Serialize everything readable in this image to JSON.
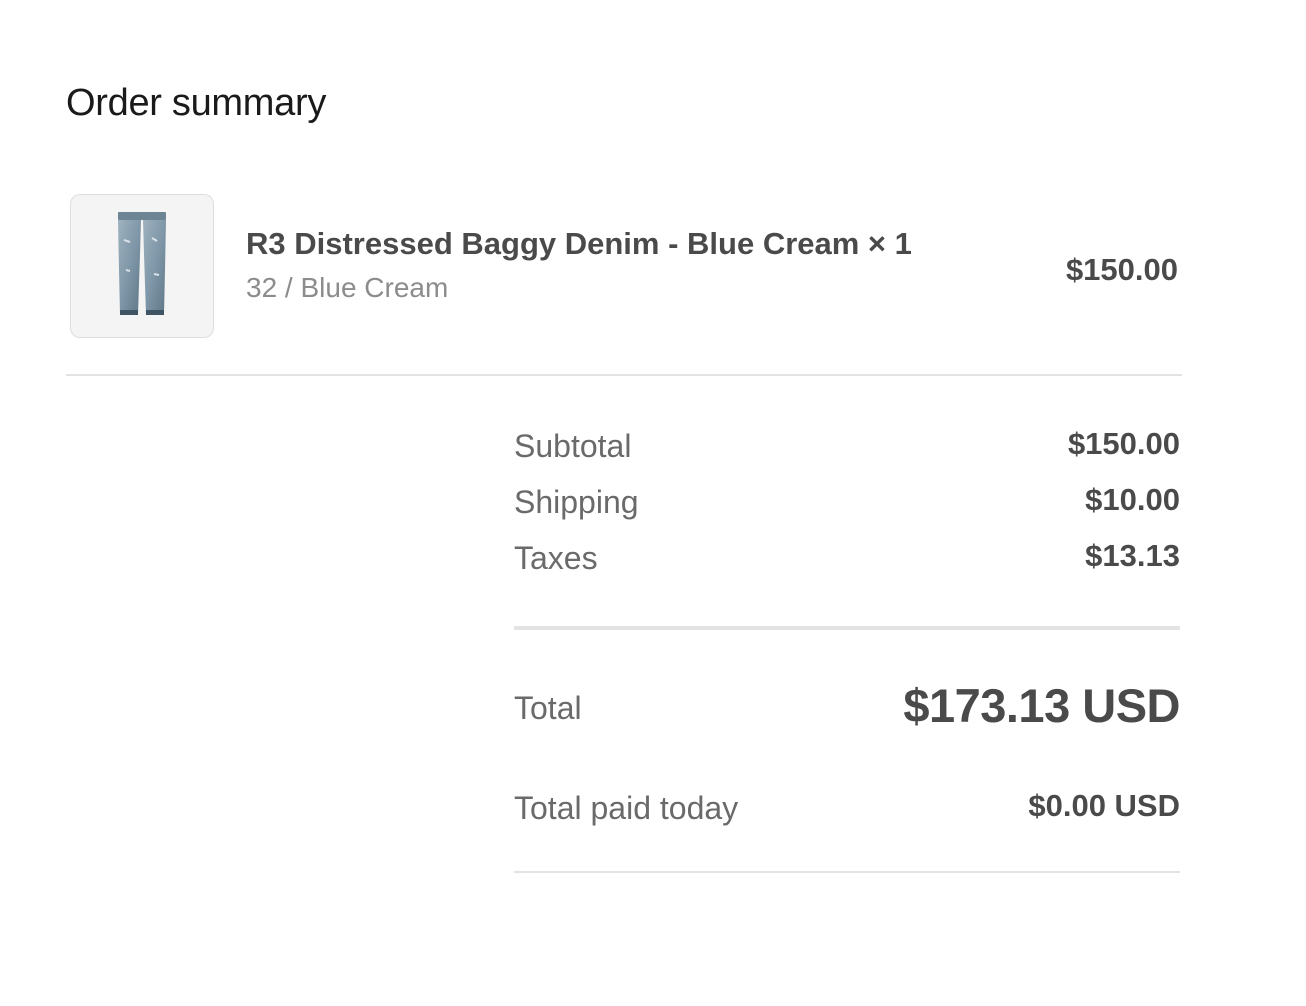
{
  "order_summary": {
    "title": "Order summary",
    "item": {
      "name": "R3 Distressed Baggy Denim - Blue Cream × 1",
      "variant": "32 / Blue Cream",
      "price": "$150.00",
      "thumbnail_icon": "jeans-icon"
    },
    "subtotal": {
      "label": "Subtotal",
      "value": "$150.00"
    },
    "shipping": {
      "label": "Shipping",
      "value": "$10.00"
    },
    "taxes": {
      "label": "Taxes",
      "value": "$13.13"
    },
    "total": {
      "label": "Total",
      "value": "$173.13 USD"
    },
    "paid_today": {
      "label": "Total paid today",
      "value": "$0.00 USD"
    }
  },
  "colors": {
    "heading": "#1a1a1a",
    "text_strong": "#4a4a4a",
    "text_muted": "#6a6a6a",
    "text_variant": "#8c8c8c",
    "divider": "#e3e3e3",
    "denim": "#7f97a8"
  }
}
